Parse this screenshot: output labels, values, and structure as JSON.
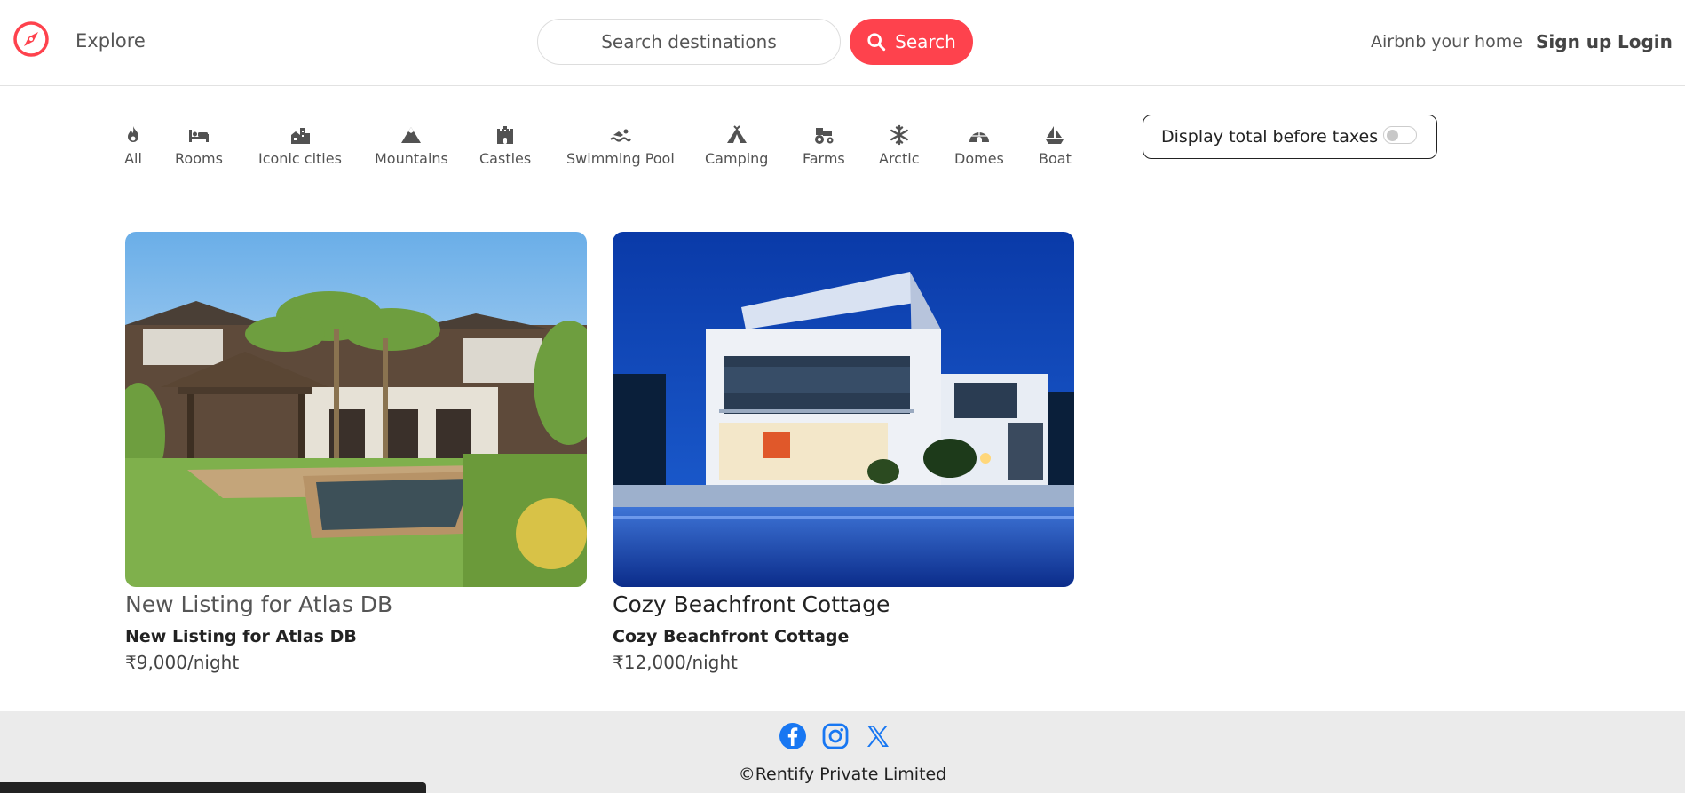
{
  "navbar": {
    "logo_icon": "compass-icon",
    "explore": "Explore",
    "search_placeholder": "Search destinations",
    "search_button": "Search",
    "host": "Airbnb your home",
    "signup": "Sign up",
    "login": "Login"
  },
  "filters": [
    {
      "label": "All",
      "icon": "fire-icon"
    },
    {
      "label": "Rooms",
      "icon": "bed-icon"
    },
    {
      "label": "Iconic cities",
      "icon": "city-icon"
    },
    {
      "label": "Mountains",
      "icon": "mountain-icon"
    },
    {
      "label": "Castles",
      "icon": "castle-icon"
    },
    {
      "label": "Swimming Pool",
      "icon": "swimmer-icon"
    },
    {
      "label": "Camping",
      "icon": "tent-icon"
    },
    {
      "label": "Farms",
      "icon": "tractor-icon"
    },
    {
      "label": "Arctic",
      "icon": "snowflake-icon"
    },
    {
      "label": "Domes",
      "icon": "igloo-icon"
    },
    {
      "label": "Boat",
      "icon": "sailboat-icon"
    }
  ],
  "tax_toggle": {
    "label": "Display total before taxes",
    "enabled": false
  },
  "listings": [
    {
      "heading": "New Listing for Atlas DB",
      "title": "New Listing for Atlas DB",
      "price": "₹9,000/night"
    },
    {
      "heading": "Cozy Beachfront Cottage",
      "title": "Cozy Beachfront Cottage",
      "price": "₹12,000/night"
    }
  ],
  "footer": {
    "socials": [
      "facebook-icon",
      "instagram-icon",
      "x-icon"
    ],
    "copyright": "©Rentify Private Limited"
  },
  "colors": {
    "brand": "#fe424d",
    "social": "#1877f2"
  }
}
